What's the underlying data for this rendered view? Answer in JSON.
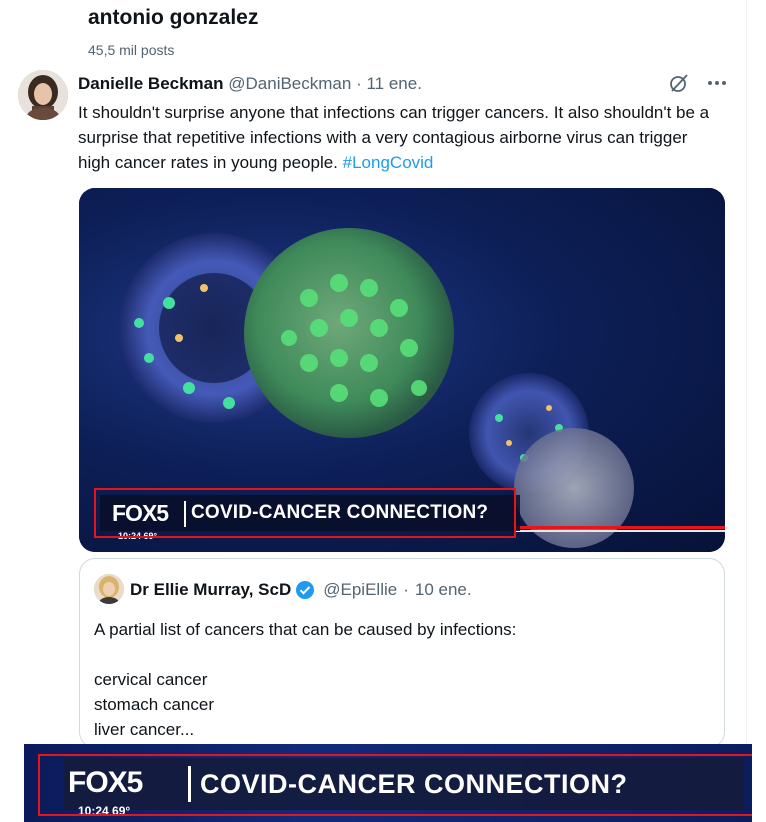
{
  "profile": {
    "name": "antonio gonzalez",
    "posts": "45,5 mil posts"
  },
  "tweet": {
    "author": "Danielle Beckman",
    "handle": "@DaniBeckman",
    "sep": "·",
    "date": "11 ene.",
    "text": "It shouldn't surprise anyone that infections can trigger cancers. It also shouldn't be a surprise that repetitive infections with a very contagious airborne virus can trigger high cancer rates in young people.",
    "hashtag": "#LongCovid",
    "media": {
      "logo": "FOX5",
      "headline": "COVID-CANCER CONNECTION?",
      "time": "10:24  69°"
    }
  },
  "quote": {
    "author": "Dr Ellie Murray, ScD",
    "handle": "@EpiEllie",
    "sep": "·",
    "date": "10 ene.",
    "intro": "A partial list of cancers that can be caused by infections:",
    "items": [
      "cervical cancer",
      "stomach cancer",
      "liver cancer..."
    ]
  },
  "zoom_banner": {
    "logo": "FOX5",
    "headline": "COVID-CANCER CONNECTION?",
    "time": "10:24  69°"
  },
  "colors": {
    "link": "#1d9bf0",
    "highlight_border": "#e5161b",
    "secondary_text": "#536471"
  },
  "icons": [
    "grok-icon",
    "more-icon",
    "verified-icon"
  ]
}
